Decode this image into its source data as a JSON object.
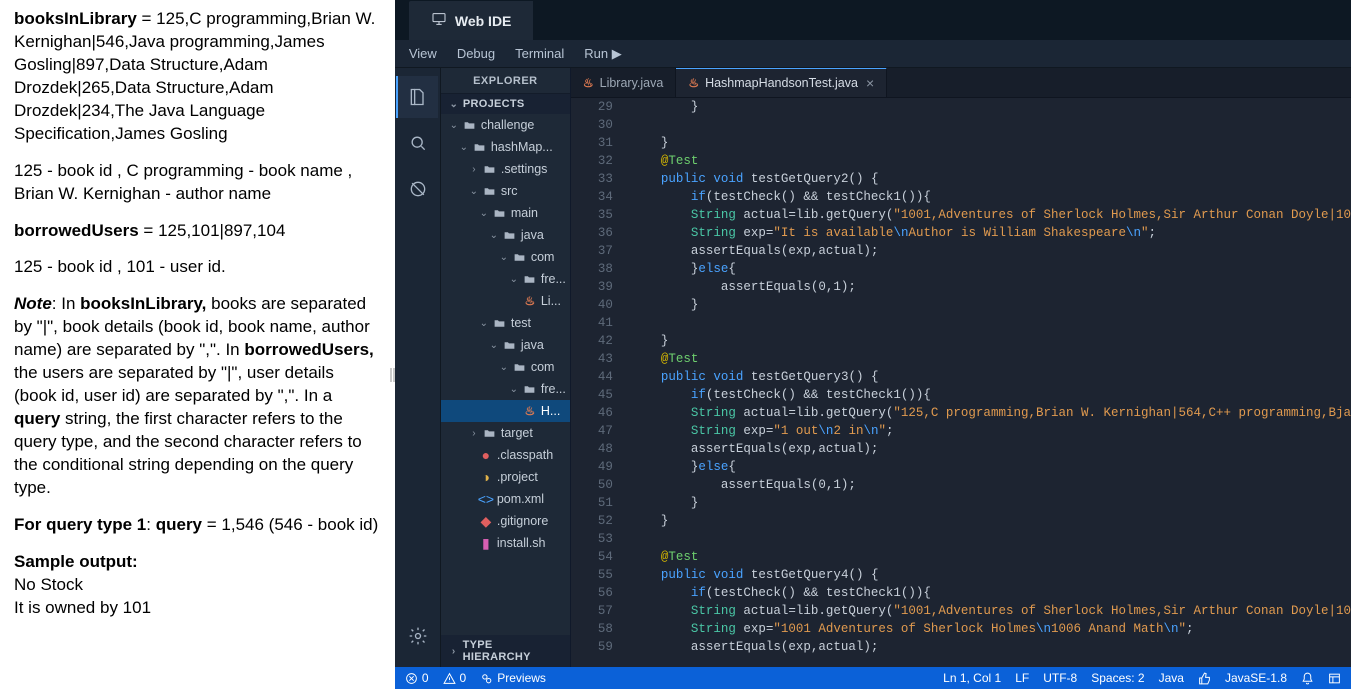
{
  "left_doc": {
    "p1_b": "booksInLibrary",
    "p1_rest": " = 125,C programming,Brian W. Kernighan|546,Java programming,James Gosling|897,Data Structure,Adam Drozdek|265,Data Structure,Adam Drozdek|234,The Java Language Specification,James Gosling",
    "p2": "125 - book id , C programming - book name , Brian W. Kernighan - author name",
    "p3_b": "borrowedUsers",
    "p3_rest": " = 125,101|897,104",
    "p4": "125 - book id , 101 - user id.",
    "p5_note": "Note",
    "p5_mid1": ": In ",
    "p5_b1": "booksInLibrary,",
    "p5_mid2": " books are separated by \"|\", book details (book id, book name, author name) are separated by \",\". In ",
    "p5_b2": "borrowedUsers,",
    "p5_mid3": " the users are separated by \"|\", user details (book id, user id) are separated by \",\". In a ",
    "p5_b3": "query",
    "p5_mid4": " string, the first character refers to the query type, and the second character refers to the conditional string depending on the query type.",
    "p6_b1": "For query type 1",
    "p6_mid1": ": ",
    "p6_b2": "query",
    "p6_mid2": " = 1,546 (546 - book id)",
    "p7_b": "Sample output:",
    "p8": "No Stock",
    "p9": "It is owned by 101"
  },
  "ide": {
    "title": "Web IDE",
    "menu": {
      "view": "View",
      "debug": "Debug",
      "terminal": "Terminal",
      "run": "Run ▶"
    },
    "explorer_title": "EXPLORER",
    "section_projects": "PROJECTS",
    "section_type": "TYPE HIERARCHY",
    "tree": {
      "challenge": "challenge",
      "hashmap": "hashMap...",
      "settings": ".settings",
      "src": "src",
      "main": "main",
      "java": "java",
      "com": "com",
      "fre": "fre...",
      "li": "Li...",
      "test": "test",
      "java2": "java",
      "com2": "com",
      "fre2": "fre...",
      "h": "H...",
      "target": "target",
      "classpath": ".classpath",
      "project": ".project",
      "pom": "pom.xml",
      "gitignore": ".gitignore",
      "install": "install.sh"
    },
    "tabs": {
      "t1": "Library.java",
      "t2": "HashmapHandsonTest.java"
    },
    "code_lines": [
      {
        "n": 29,
        "html": "        }"
      },
      {
        "n": 30,
        "html": ""
      },
      {
        "n": 31,
        "html": "    }"
      },
      {
        "n": 32,
        "html": "    <span class='tok-at'>@</span><span class='tok-test'>Test</span>"
      },
      {
        "n": 33,
        "html": "    <span class='tok-kw'>public</span> <span class='tok-kw'>void</span> testGetQuery2() {"
      },
      {
        "n": 34,
        "html": "        <span class='tok-kw'>if</span>(testCheck() && testCheck1()){"
      },
      {
        "n": 35,
        "html": "        <span class='tok-type'>String</span> actual=lib.getQuery(<span class='tok-str'>\"1001,Adventures of Sherlock Holmes,Sir Arthur Conan Doyle|10</span>"
      },
      {
        "n": 36,
        "html": "        <span class='tok-type'>String</span> exp=<span class='tok-str'>\"It is available<span class='tok-esc'>\\n</span>Author is William Shakespeare<span class='tok-esc'>\\n</span>\"</span>;"
      },
      {
        "n": 37,
        "html": "        assertEquals(exp,actual);"
      },
      {
        "n": 38,
        "html": "        }<span class='tok-kw'>else</span>{"
      },
      {
        "n": 39,
        "html": "            assertEquals(0,1);"
      },
      {
        "n": 40,
        "html": "        }"
      },
      {
        "n": 41,
        "html": ""
      },
      {
        "n": 42,
        "html": "    }"
      },
      {
        "n": 43,
        "html": "    <span class='tok-at'>@</span><span class='tok-test'>Test</span>"
      },
      {
        "n": 44,
        "html": "    <span class='tok-kw'>public</span> <span class='tok-kw'>void</span> testGetQuery3() {"
      },
      {
        "n": 45,
        "html": "        <span class='tok-kw'>if</span>(testCheck() && testCheck1()){"
      },
      {
        "n": 46,
        "html": "        <span class='tok-type'>String</span> actual=lib.getQuery(<span class='tok-str'>\"125,C programming,Brian W. Kernighan|564,C++ programming,Bja</span>"
      },
      {
        "n": 47,
        "html": "        <span class='tok-type'>String</span> exp=<span class='tok-str'>\"1 out<span class='tok-esc'>\\n</span>2 in<span class='tok-esc'>\\n</span>\"</span>;"
      },
      {
        "n": 48,
        "html": "        assertEquals(exp,actual);"
      },
      {
        "n": 49,
        "html": "        }<span class='tok-kw'>else</span>{"
      },
      {
        "n": 50,
        "html": "            assertEquals(0,1);"
      },
      {
        "n": 51,
        "html": "        }"
      },
      {
        "n": 52,
        "html": "    }"
      },
      {
        "n": 53,
        "html": ""
      },
      {
        "n": 54,
        "html": "    <span class='tok-at'>@</span><span class='tok-test'>Test</span>"
      },
      {
        "n": 55,
        "html": "    <span class='tok-kw'>public</span> <span class='tok-kw'>void</span> testGetQuery4() {"
      },
      {
        "n": 56,
        "html": "        <span class='tok-kw'>if</span>(testCheck() && testCheck1()){"
      },
      {
        "n": 57,
        "html": "        <span class='tok-type'>String</span> actual=lib.getQuery(<span class='tok-str'>\"1001,Adventures of Sherlock Holmes,Sir Arthur Conan Doyle|10</span>"
      },
      {
        "n": 58,
        "html": "        <span class='tok-type'>String</span> exp=<span class='tok-str'>\"1001 Adventures of Sherlock Holmes<span class='tok-esc'>\\n</span>1006 Anand Math<span class='tok-esc'>\\n</span>\"</span>;"
      },
      {
        "n": 59,
        "html": "        assertEquals(exp,actual);"
      }
    ],
    "status": {
      "errors": "0",
      "warnings": "0",
      "previews": "Previews",
      "lncol": "Ln 1, Col 1",
      "lf": "LF",
      "enc": "UTF-8",
      "spaces": "Spaces: 2",
      "lang": "Java",
      "sdk": "JavaSE-1.8"
    }
  }
}
